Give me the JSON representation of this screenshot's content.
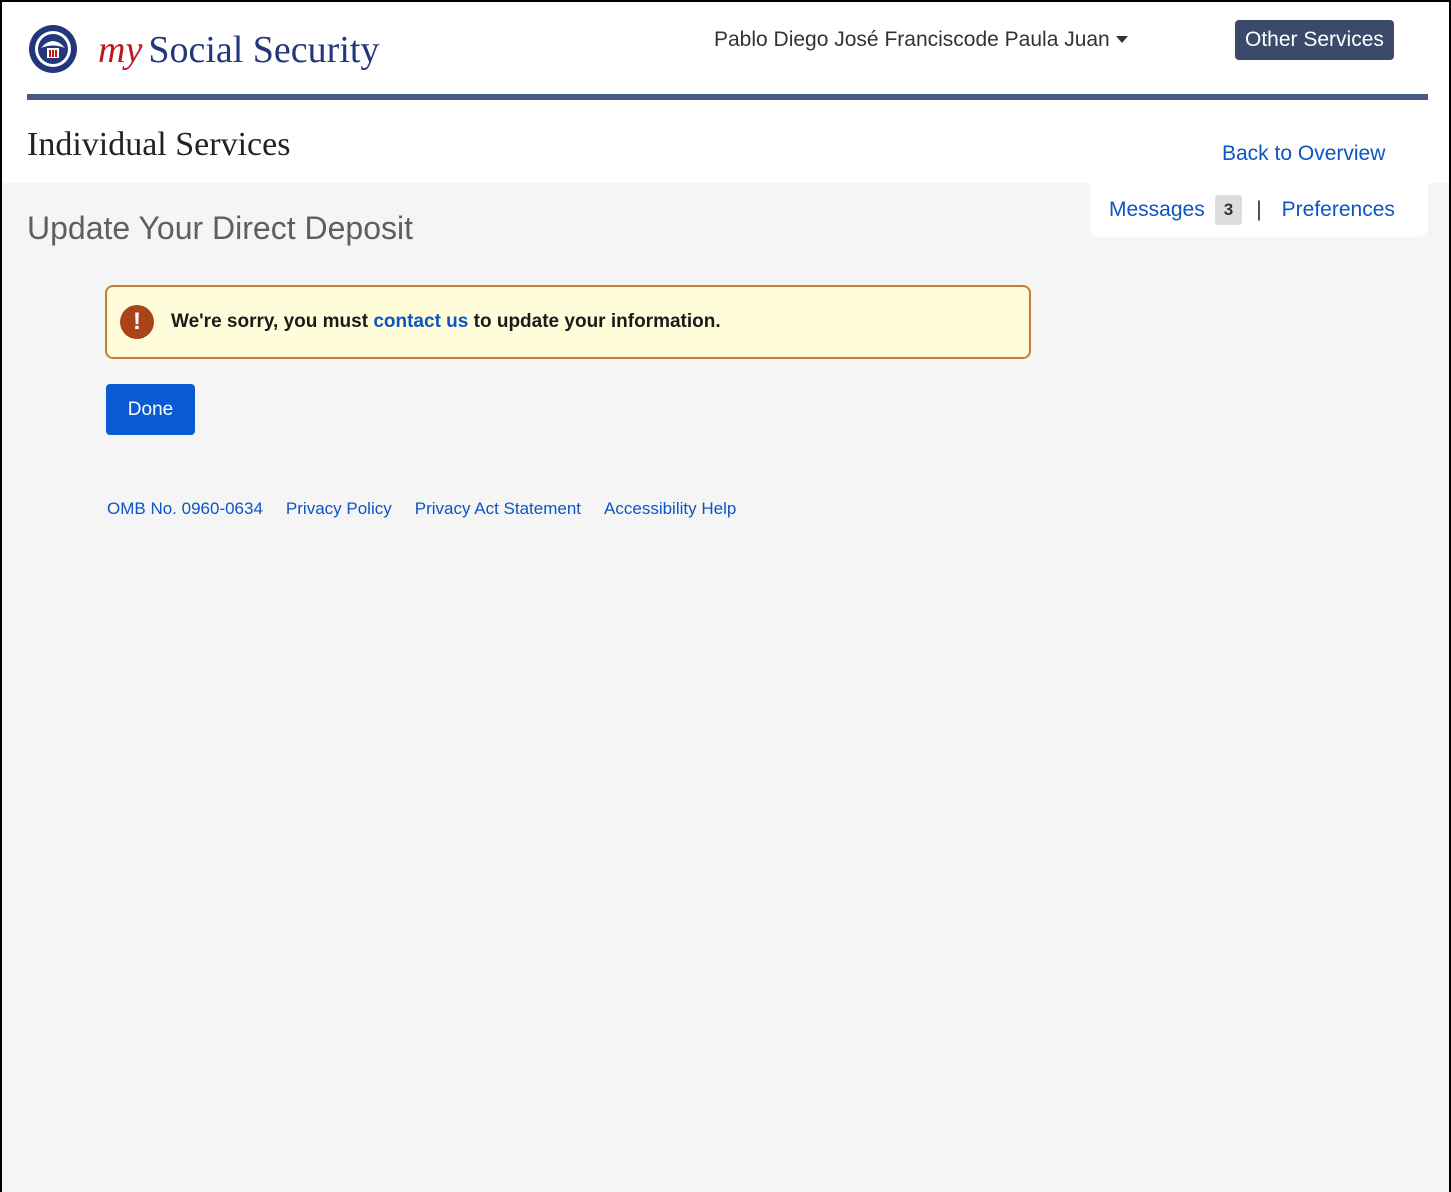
{
  "header": {
    "brand_my": "my",
    "brand_name": "Social Security",
    "user_name": "Pablo Diego José Franciscode Paula Juan",
    "other_services_label": "Other Services",
    "colors": {
      "brand_navy": "#23387a",
      "brand_red": "#c0161f",
      "rule": "#4a5a86",
      "other_services_bg": "#3b4a6b"
    }
  },
  "section": {
    "title": "Individual Services",
    "back_link": "Back  to Overview"
  },
  "tools": {
    "messages_label": "Messages",
    "messages_count": "3",
    "separator": "|",
    "preferences_label": "Preferences"
  },
  "page": {
    "heading": "Update Your Direct Deposit"
  },
  "alert": {
    "icon": "exclamation-icon",
    "text_before": "We're sorry, you must ",
    "link_text": "contact us",
    "text_after": " to update your information.",
    "colors": {
      "background": "#fffdd9",
      "border": "#c57d3a",
      "icon": "#a8431a"
    }
  },
  "actions": {
    "done_label": "Done",
    "done_color": "#0a5bd3"
  },
  "footer": {
    "links": [
      "OMB No. 0960-0634",
      "Privacy Policy",
      "Privacy Act Statement",
      "Accessibility Help"
    ],
    "link_color": "#0b55c4"
  }
}
